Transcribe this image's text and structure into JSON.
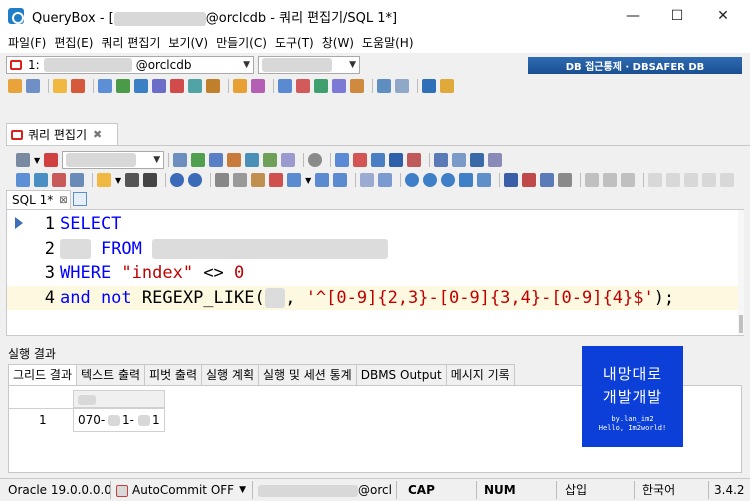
{
  "window": {
    "app_name": "QueryBox",
    "title_dash": " - ",
    "title_conn_suffix": "@orclcdb - 쿼리 편집기/SQL 1*]",
    "bracket_open": "[",
    "minimize": "—",
    "maximize": "☐",
    "close": "✕"
  },
  "menu": [
    "파일(F)",
    "편집(E)",
    "쿼리 편집기",
    "보기(V)",
    "만들기(C)",
    "도구(T)",
    "창(W)",
    "도움말(H)"
  ],
  "connection": {
    "prefix": "1:",
    "suffix": "@orclcdb",
    "banner": "DB 접근통제 · DBSAFER DB"
  },
  "editor_tab": {
    "label": "쿼리 편집기",
    "close": "✖"
  },
  "sql_tab": {
    "label": "SQL 1*",
    "close": "⊠"
  },
  "code": {
    "lines": [
      {
        "num": "1",
        "parts": [
          {
            "t": "SELECT",
            "c": "kw"
          }
        ]
      },
      {
        "num": "2",
        "parts": [
          {
            "t": "   ",
            "c": "blur"
          },
          {
            "t": " FROM ",
            "c": "kw"
          },
          {
            "t": "                       ",
            "c": "blur"
          }
        ]
      },
      {
        "num": "3",
        "parts": [
          {
            "t": "WHERE ",
            "c": "kw"
          },
          {
            "t": "\"index\"",
            "c": "str"
          },
          {
            "t": " <> ",
            "c": ""
          },
          {
            "t": "0",
            "c": "str"
          }
        ]
      },
      {
        "num": "4",
        "parts": [
          {
            "t": "and not ",
            "c": "kw"
          },
          {
            "t": "REGEXP_LIKE(",
            "c": ""
          },
          {
            "t": "  ",
            "c": "blur"
          },
          {
            "t": ", ",
            "c": ""
          },
          {
            "t": "'^[0-9]{2,3}-[0-9]{3,4}-[0-9]{4}$'",
            "c": "str"
          },
          {
            "t": ");",
            "c": ""
          }
        ]
      }
    ]
  },
  "results": {
    "header": "실행 결과",
    "tabs": [
      "그리드 결과",
      "텍스트 출력",
      "피벗 출력",
      "실행 계획",
      "실행 및 세션 통계",
      "DBMS Output",
      "메시지 기록"
    ],
    "row_num": "1",
    "cell_parts": [
      "070-",
      "1-",
      "1"
    ]
  },
  "banner": {
    "line1": "내망대로",
    "line2": "개발개발",
    "line3": "by.lan_im2",
    "line4": "Hello, Im2world!"
  },
  "status": {
    "oracle": "Oracle 19.0.0.0.0",
    "autocommit": "AutoCommit OFF",
    "conn_suffix": "@orcl",
    "cap": "CAP",
    "num": "NUM",
    "insert": "삽입",
    "lang": "한국어",
    "version": "3.4.2"
  }
}
